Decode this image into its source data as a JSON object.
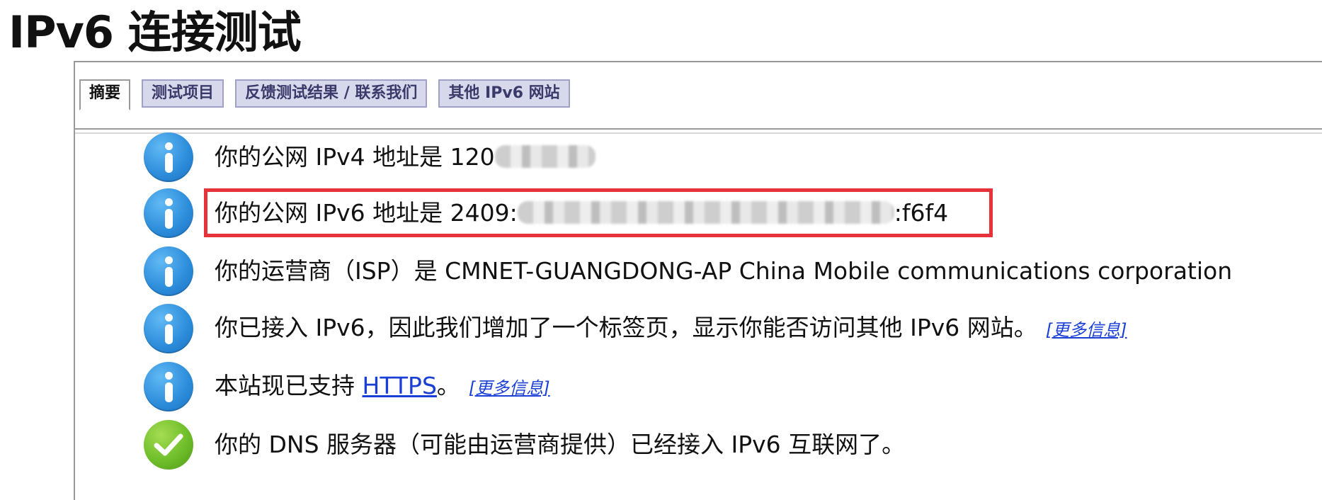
{
  "page": {
    "title": "IPv6 连接测试"
  },
  "tabs": [
    {
      "label": "摘要",
      "active": true
    },
    {
      "label": "测试项目",
      "active": false
    },
    {
      "label": "反馈测试结果 / 联系我们",
      "active": false
    },
    {
      "label": "其他 IPv6 网站",
      "active": false
    }
  ],
  "rows": [
    {
      "icon": "info-icon",
      "prefix": "你的公网 IPv4 地址是 120",
      "suffix": ""
    },
    {
      "icon": "info-icon",
      "prefix": "你的公网 IPv6 地址是 2409:",
      "suffix": ":f6f4"
    },
    {
      "icon": "info-icon",
      "text": "你的运营商（ISP）是 CMNET-GUANGDONG-AP China Mobile communications corporation"
    },
    {
      "icon": "info-icon",
      "text": "你已接入 IPv6，因此我们增加了一个标签页，显示你能否访问其他 IPv6 网站。",
      "link": "[更多信息]"
    },
    {
      "icon": "info-icon",
      "text_before": "本站现已支持 ",
      "link_inline": "HTTPS",
      "text_after": "。",
      "link": "[更多信息]"
    },
    {
      "icon": "check-icon",
      "text": "你的 DNS 服务器（可能由运营商提供）已经接入 IPv6 互联网了。"
    }
  ],
  "colors": {
    "highlight": "#e8323a",
    "link": "#1a3fd6",
    "info": "#2e8fdc",
    "success": "#6fbe2a"
  }
}
